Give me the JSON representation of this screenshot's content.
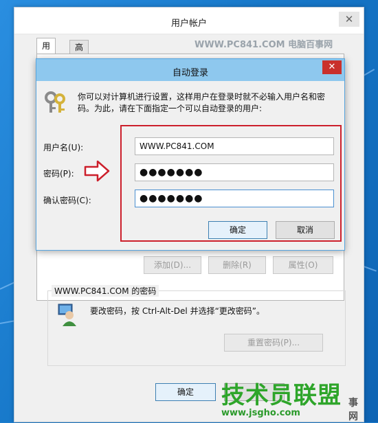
{
  "outer_window": {
    "title": "用户帐户",
    "close_label": "✕",
    "tabs": [
      {
        "label": "用户"
      },
      {
        "label": "高级"
      }
    ],
    "watermark": "WWW.PC841.COM 电脑百事网",
    "buttons": {
      "add": "添加(D)...",
      "delete": "删除(R)",
      "properties": "属性(O)",
      "ok": "确定"
    },
    "password_group": {
      "title": "WWW.PC841.COM 的密码",
      "text": "要改密码，按 Ctrl-Alt-Del 并选择“更改密码”。",
      "reset_button": "重置密码(P)..."
    }
  },
  "dialog": {
    "title": "自动登录",
    "close_label": "✕",
    "description": "你可以对计算机进行设置，这样用户在登录时就不必输入用户名和密码。为此，请在下面指定一个可以自动登录的用户:",
    "fields": {
      "username_label": "用户名(U):",
      "username_value": "WWW.PC841.COM",
      "password_label": "密码(P):",
      "password_value": "●●●●●●●",
      "confirm_label": "确认密码(C):",
      "confirm_value": "●●●●●●●"
    },
    "ok_button": "确定",
    "cancel_button": "取消"
  },
  "site_watermark": {
    "brand": "技术员联盟",
    "url": "www.jsgho.com",
    "small_text": "事网"
  },
  "colors": {
    "dialog_title_bg": "#8ec8ee",
    "close_red": "#c9302c",
    "highlight_red": "#cc1f2b",
    "watermark_green": "#2ea52a",
    "desktop_blue": "#1677c8"
  }
}
